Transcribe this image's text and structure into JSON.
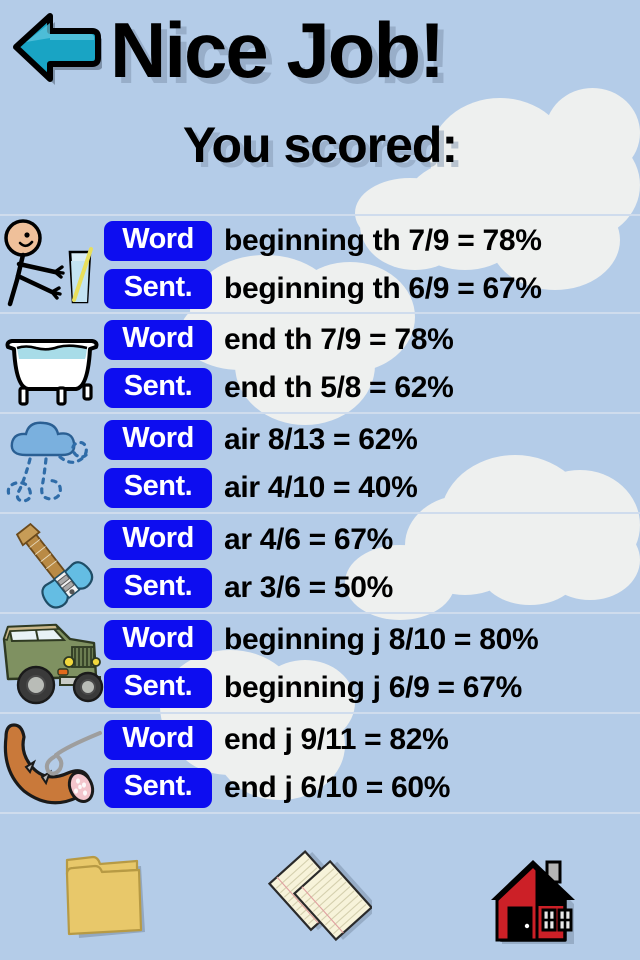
{
  "header": {
    "back_label": "back-arrow",
    "title": "Nice Job!",
    "subtitle": "You scored:",
    "arrow_color": "#19a4c4",
    "title_color": "#000000",
    "shadow_color": "#8296af"
  },
  "theme": {
    "background": "#b4cce8",
    "cloud": "#eef0ef",
    "badge_blue": "#0d0df0",
    "badge_text": "#ffffff",
    "row_divider": "#cfdced"
  },
  "rows": [
    {
      "icon": "stick-figure-drinking-glass-icon",
      "lines": [
        {
          "badge": "Word",
          "text": "beginning th 7/9 = 78%"
        },
        {
          "badge": "Sent.",
          "text": "beginning th 6/9 = 67%"
        }
      ]
    },
    {
      "icon": "bathtub-icon",
      "lines": [
        {
          "badge": "Word",
          "text": "end th 7/9 = 78%"
        },
        {
          "badge": "Sent.",
          "text": "end th 5/8 = 62%"
        }
      ]
    },
    {
      "icon": "air-wind-cloud-icon",
      "lines": [
        {
          "badge": "Word",
          "text": "air 8/13 = 62%"
        },
        {
          "badge": "Sent.",
          "text": "air 4/10 = 40%"
        }
      ]
    },
    {
      "icon": "electric-guitar-icon",
      "lines": [
        {
          "badge": "Word",
          "text": "ar 4/6 = 67%"
        },
        {
          "badge": "Sent.",
          "text": "ar 3/6 = 50%"
        }
      ]
    },
    {
      "icon": "jeep-icon",
      "lines": [
        {
          "badge": "Word",
          "text": "beginning j 8/10 = 80%"
        },
        {
          "badge": "Sent.",
          "text": "beginning j 6/9 = 67%"
        }
      ]
    },
    {
      "icon": "sausage-on-fork-icon",
      "lines": [
        {
          "badge": "Word",
          "text": "end j 9/11 = 82%"
        },
        {
          "badge": "Sent.",
          "text": "end j 6/10 = 60%"
        }
      ]
    }
  ],
  "toolbar": {
    "items": [
      {
        "icon": "folder-icon",
        "label": "Folder"
      },
      {
        "icon": "notes-papers-icon",
        "label": "Notes"
      },
      {
        "icon": "home-house-icon",
        "label": "Home"
      }
    ]
  }
}
